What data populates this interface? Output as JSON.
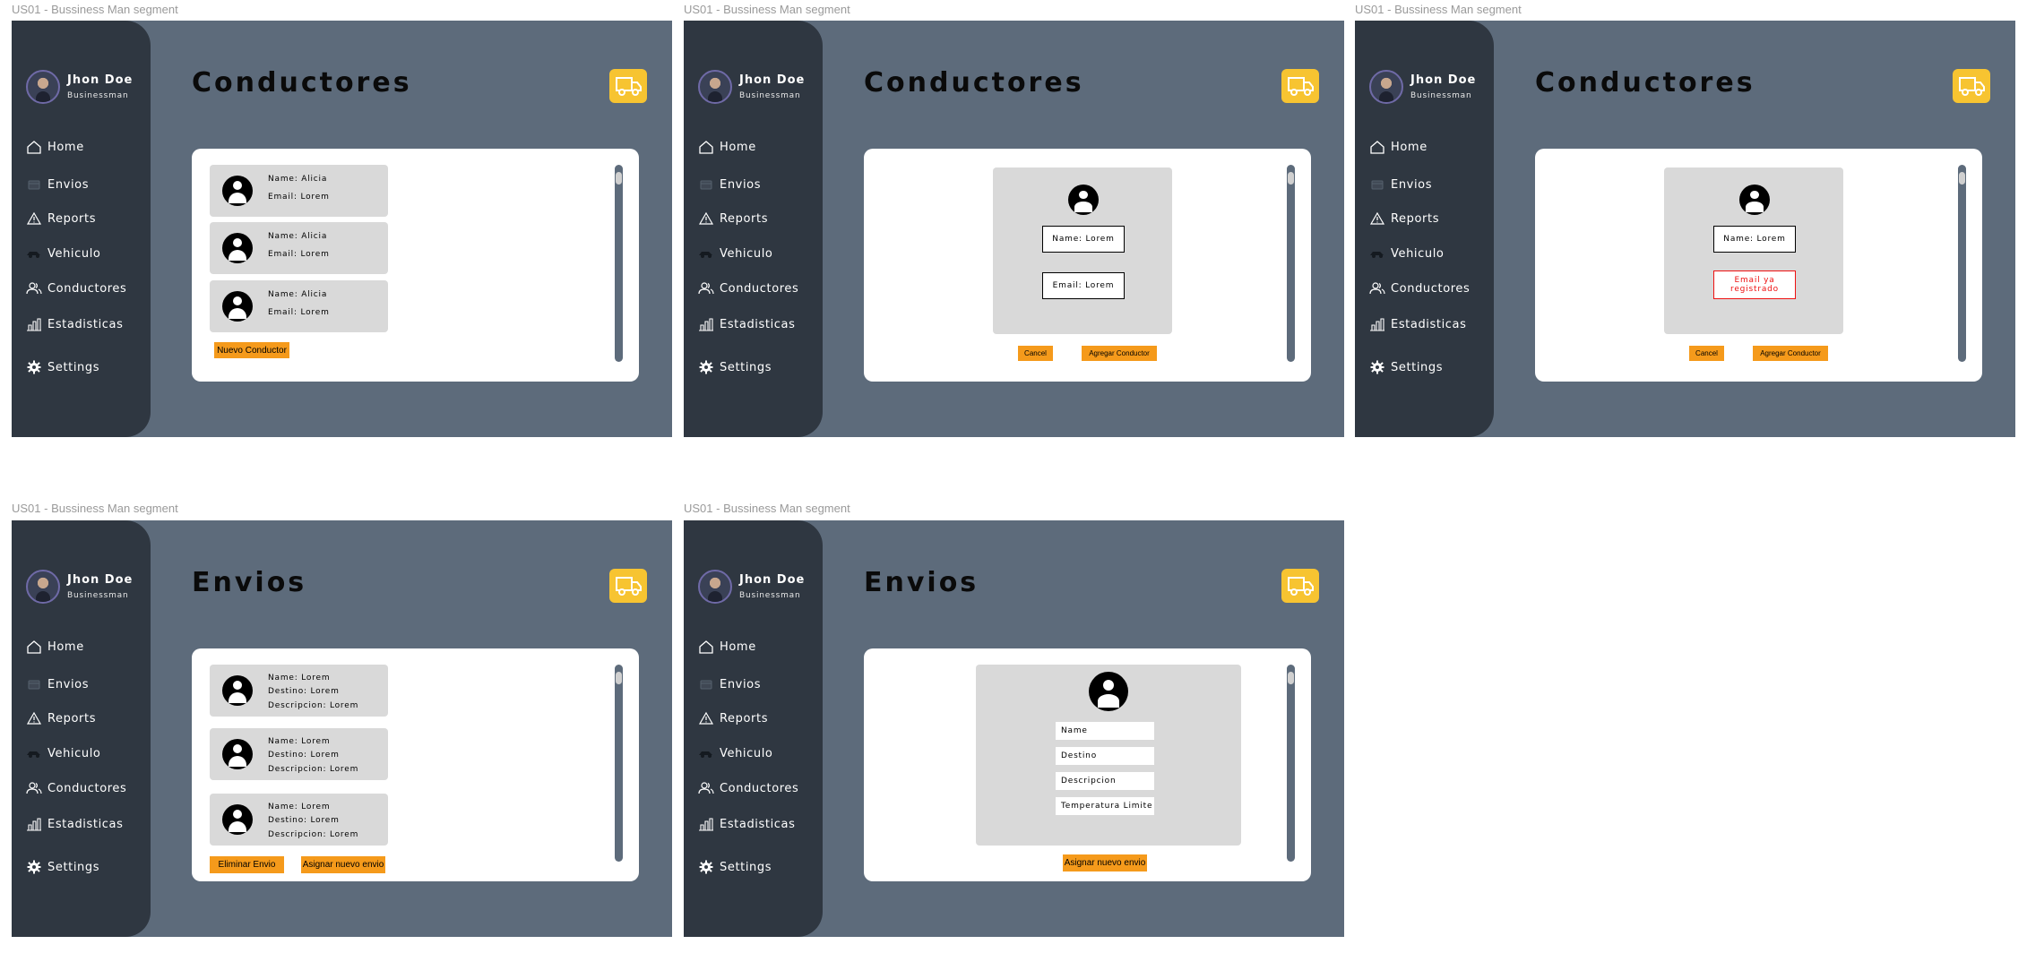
{
  "colors": {
    "frame_bg": "#5d6b7b",
    "sidebar_bg": "#2f3741",
    "accent": "#f59a1b",
    "truck": "#f7c431",
    "error": "#e11111"
  },
  "frame_label": "US01 - Bussiness Man segment",
  "profile": {
    "name": "Jhon Doe",
    "role": "Businessman"
  },
  "nav": {
    "home": "Home",
    "envios": "Envios",
    "reports": "Reports",
    "vehiculo": "Vehiculo",
    "conductores": "Conductores",
    "estadisticas": "Estadisticas",
    "settings": "Settings"
  },
  "icons": [
    "home-icon",
    "envios-icon",
    "reports-icon",
    "vehicle-icon",
    "users-icon",
    "stats-icon",
    "gear-icon",
    "truck-icon"
  ],
  "frames": [
    {
      "title": "Conductores",
      "drivers": [
        {
          "name": "Name: Alicia",
          "email": "Email: Lorem"
        },
        {
          "name": "Name: Alicia",
          "email": "Email: Lorem"
        },
        {
          "name": "Name: Alicia",
          "email": "Email: Lorem"
        }
      ],
      "new_button": "Nuevo Conductor"
    },
    {
      "title": "Conductores",
      "name_field": "Name: Lorem",
      "email_field": "Email: Lorem",
      "cancel": "Cancel",
      "add": "Agregar Conductor"
    },
    {
      "title": "Conductores",
      "name_field": "Name: Lorem",
      "email_error": "Email ya registrado",
      "cancel": "Cancel",
      "add": "Agregar Conductor"
    },
    {
      "title": "Envios",
      "shipments": [
        {
          "name": "Name: Lorem",
          "destino": "Destino: Lorem",
          "descripcion": "Descripcion: Lorem"
        },
        {
          "name": "Name: Lorem",
          "destino": "Destino: Lorem",
          "descripcion": "Descripcion: Lorem"
        },
        {
          "name": "Name: Lorem",
          "destino": "Destino: Lorem",
          "descripcion": "Descripcion: Lorem"
        }
      ],
      "delete_button": "Eliminar Envio",
      "assign_button": "Asignar nuevo envio"
    },
    {
      "title": "Envios",
      "fields": [
        "Name",
        "Destino",
        "Descripcion",
        "Temperatura Limite"
      ],
      "assign_button": "Asignar nuevo envio"
    }
  ]
}
